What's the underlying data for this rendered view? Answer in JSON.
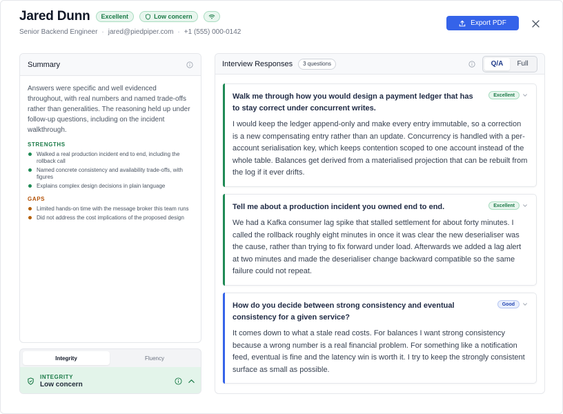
{
  "candidate": {
    "name": "Jared Dunn",
    "rating_badge": "Excellent",
    "concern_badge": "Low concern",
    "connection_icon": "wifi-icon",
    "role": "Senior Backend Engineer",
    "email": "jared@piedpiper.com",
    "phone": "+1 (555) 000-0142"
  },
  "actions": {
    "export_label": "Export PDF"
  },
  "summary": {
    "title": "Summary",
    "text": "Answers were specific and well evidenced throughout, with real numbers and named trade-offs rather than generalities. The reasoning held up under follow-up questions, including on the incident walkthrough.",
    "strengths_label": "STRENGTHS",
    "strengths": [
      "Walked a real production incident end to end, including the rollback call",
      "Named concrete consistency and availability trade-offs, with figures",
      "Explains complex design decisions in plain language"
    ],
    "gaps_label": "GAPS",
    "gaps": [
      "Limited hands-on time with the message broker this team runs",
      "Did not address the cost implications of the proposed design"
    ]
  },
  "integrity_panel": {
    "tabs": [
      "Integrity",
      "Fluency"
    ],
    "active_tab": "Integrity",
    "kicker": "INTEGRITY",
    "value": "Low concern"
  },
  "interview": {
    "title": "Interview Responses",
    "count_label": "3 questions",
    "view_options": [
      "Q/A",
      "Full"
    ],
    "active_view": "Q/A",
    "items": [
      {
        "question": "Walk me through how you would design a payment ledger that has to stay correct under concurrent writes.",
        "rating": "Excellent",
        "answer": "I would keep the ledger append-only and make every entry immutable, so a correction is a new compensating entry rather than an update. Concurrency is handled with a per-account serialisation key, which keeps contention scoped to one account instead of the whole table. Balances get derived from a materialised projection that can be rebuilt from the log if it ever drifts."
      },
      {
        "question": "Tell me about a production incident you owned end to end.",
        "rating": "Excellent",
        "answer": "We had a Kafka consumer lag spike that stalled settlement for about forty minutes. I called the rollback roughly eight minutes in once it was clear the new deserialiser was the cause, rather than trying to fix forward under load. Afterwards we added a lag alert at two minutes and made the deserialiser change backward compatible so the same failure could not repeat."
      },
      {
        "question": "How do you decide between strong consistency and eventual consistency for a given service?",
        "rating": "Good",
        "answer": "It comes down to what a stale read costs. For balances I want strong consistency because a wrong number is a real financial problem. For something like a notification feed, eventual is fine and the latency win is worth it. I try to keep the strongly consistent surface as small as possible."
      }
    ]
  },
  "colors": {
    "accent": "#3563e9",
    "success": "#1a7a47",
    "warning": "#b45309"
  }
}
